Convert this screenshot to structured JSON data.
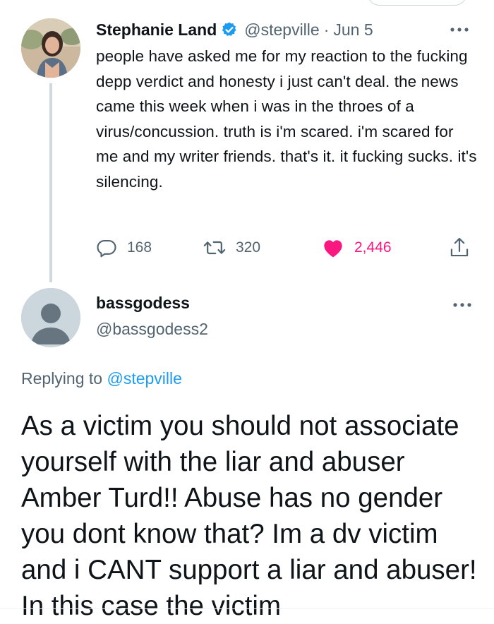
{
  "original_tweet": {
    "author_name": "Stephanie Land",
    "handle": "@stepville",
    "separator": "·",
    "date": "Jun 5",
    "text": "people have asked me for my reaction to the fucking depp verdict and honesty i just can't deal. the news came this week when i was in the throes of a virus/concussion. truth is i'm scared. i'm scared for me and my writer friends. that's it. it fucking sucks. it's silencing.",
    "replies": "168",
    "retweets": "320",
    "likes": "2,446"
  },
  "reply_tweet": {
    "author_name": "bassgodess",
    "handle": "@bassgodess2",
    "replying_label": "Replying to",
    "replying_to": "@stepville",
    "text": "As a victim you should not associate yourself with the liar and abuser Amber Turd!! Abuse has no gender you dont know that? Im a dv victim and i CANT support a liar and abuser! In this case the victim"
  },
  "colors": {
    "primary_text": "#0f1419",
    "secondary_text": "#536471",
    "link": "#1d9bf0",
    "like": "#f91880",
    "verified": "#1d9bf0"
  },
  "icons": [
    "verified-badge-icon",
    "more-icon",
    "reply-icon",
    "retweet-icon",
    "like-icon",
    "share-icon",
    "default-avatar-icon"
  ]
}
